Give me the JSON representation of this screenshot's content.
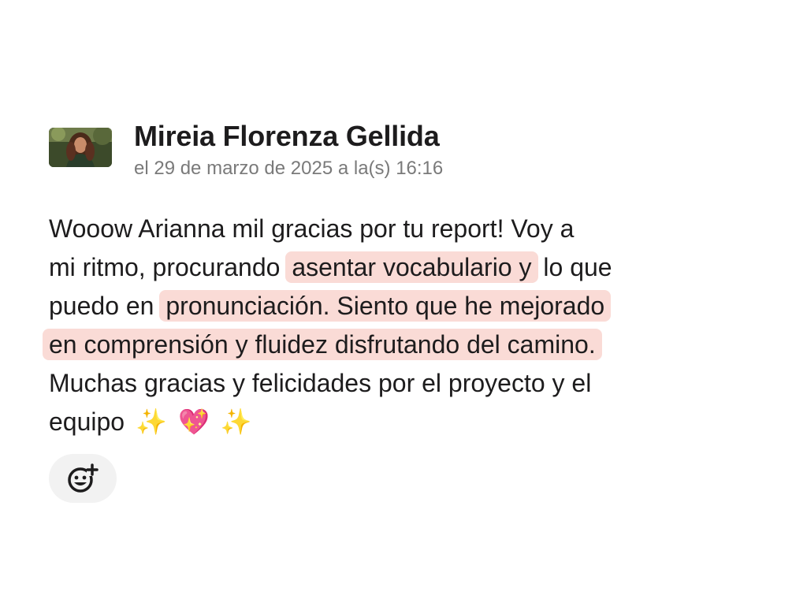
{
  "message": {
    "author": "Mireia Florenza Gellida",
    "timestamp": "el 29 de marzo de 2025 a la(s) 16:16",
    "lines": [
      {
        "plain_before": "Wooow Arianna mil gracias por tu report! Voy a"
      },
      {
        "plain_before": "mi ritmo, procurando ",
        "highlight": "asentar vocabulario y",
        "plain_after": " lo que"
      },
      {
        "plain_before": "puedo en ",
        "highlight": "pronunciación. Siento que he mejorado"
      },
      {
        "highlight": "en comprensión y fluidez disfrutando del camino."
      },
      {
        "plain_before": "Muchas gracias y felicidades por el proyecto y el"
      },
      {
        "plain_before": "equipo"
      }
    ],
    "emojis": [
      {
        "icon": "sparkles-icon",
        "glyph": "✨"
      },
      {
        "icon": "sparkling-heart-icon",
        "glyph": "💖"
      },
      {
        "icon": "sparkles-icon",
        "glyph": "✨"
      }
    ],
    "highlight_color": "#fadbd6"
  },
  "reaction_button": {
    "icon": "add-reaction-icon"
  }
}
